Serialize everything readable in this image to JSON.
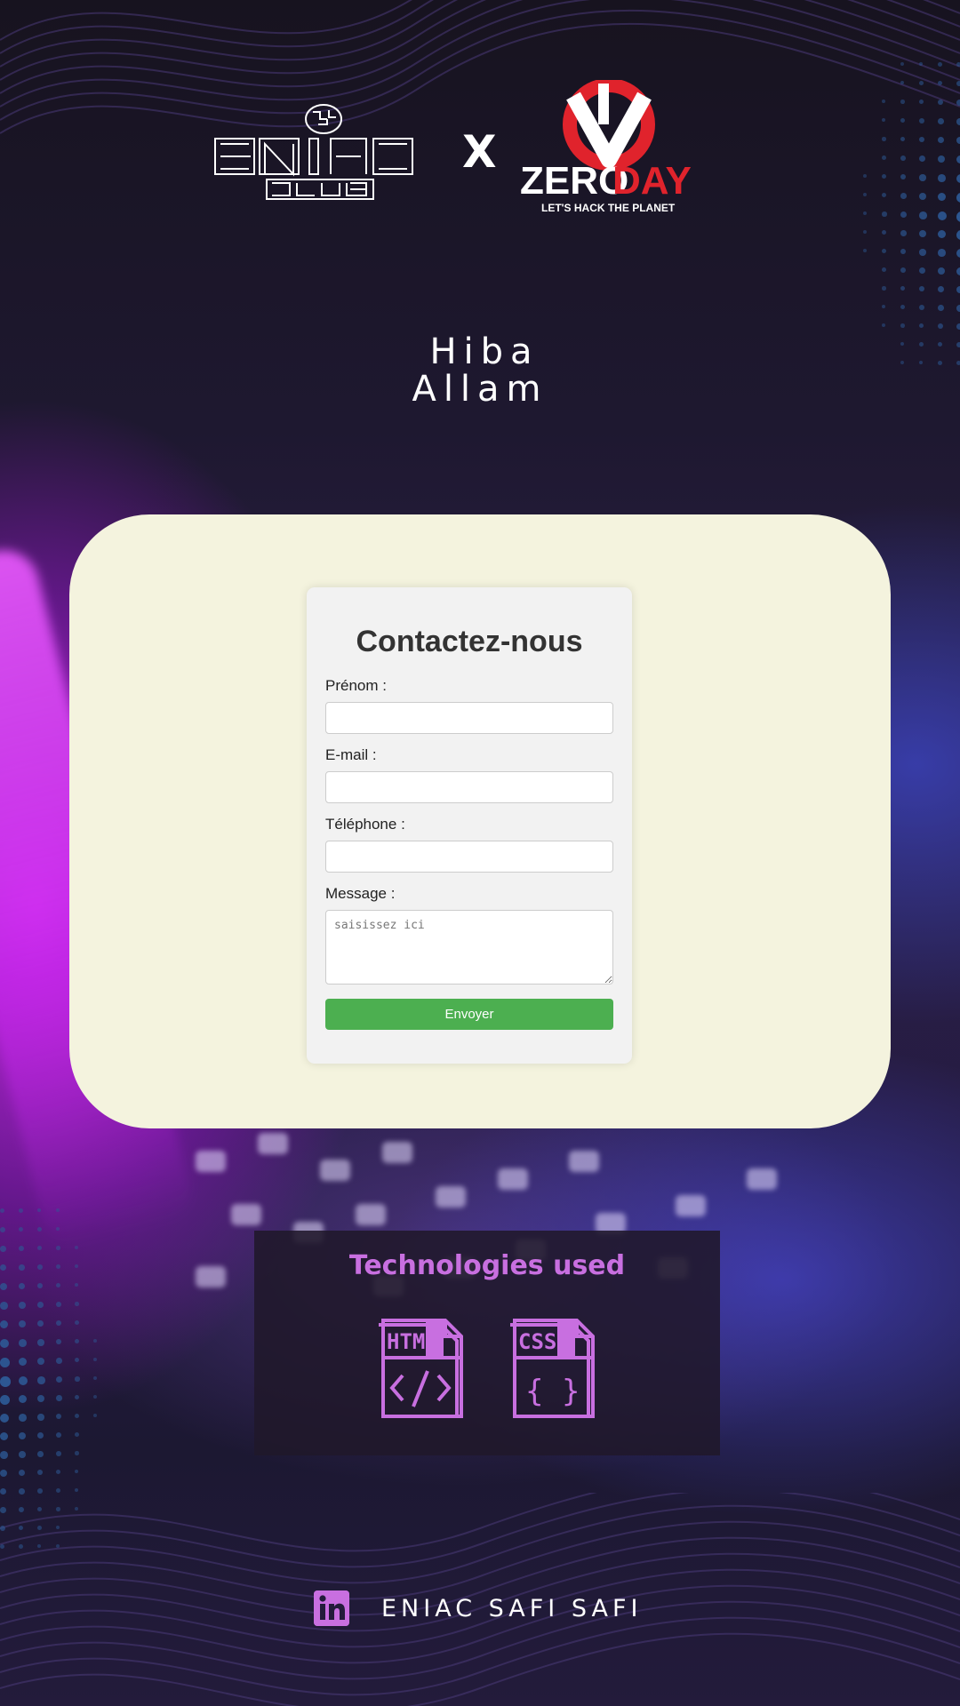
{
  "header": {
    "logo_left": "ENIAC CLUB",
    "separator": "X",
    "logo_right_main_white": "ZERO",
    "logo_right_main_red": "DAY",
    "logo_right_tagline": "LET'S HACK THE PLANET"
  },
  "author": {
    "first_name": "Hiba",
    "last_name": "Allam"
  },
  "contact_form": {
    "title": "Contactez-nous",
    "fields": {
      "prenom": {
        "label": "Prénom :",
        "value": "",
        "placeholder": ""
      },
      "email": {
        "label": "E-mail :",
        "value": "",
        "placeholder": ""
      },
      "telephone": {
        "label": "Téléphone :",
        "value": "",
        "placeholder": ""
      },
      "message": {
        "label": "Message :",
        "value": "",
        "placeholder": "saisissez ici"
      }
    },
    "submit_label": "Envoyer"
  },
  "technologies": {
    "title": "Technologies used",
    "items": [
      {
        "icon": "html-file-icon",
        "label": "HTM"
      },
      {
        "icon": "css-file-icon",
        "label": "CSS"
      }
    ]
  },
  "footer": {
    "icon": "linkedin-icon",
    "text": "ENIAC SAFI SAFI"
  },
  "colors": {
    "card_background": "#f4f3de",
    "button_green": "#4caf50",
    "accent_purple": "#c86fe0",
    "zeroday_red": "#e0232c"
  }
}
